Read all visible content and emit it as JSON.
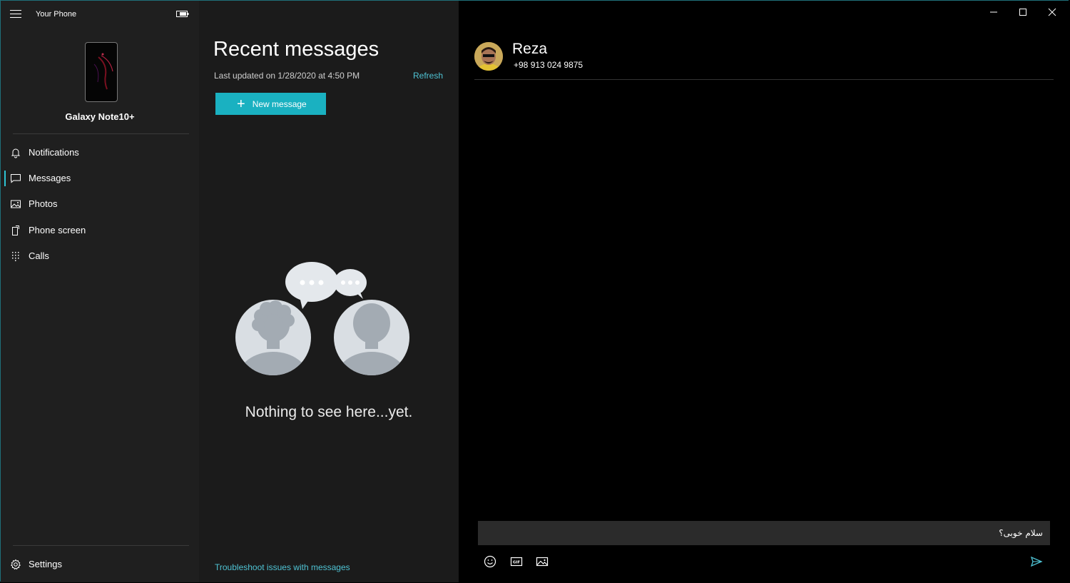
{
  "app": {
    "title": "Your Phone"
  },
  "device": {
    "name": "Galaxy Note10+"
  },
  "sidebar": {
    "items": [
      {
        "label": "Notifications",
        "icon": "bell-icon"
      },
      {
        "label": "Messages",
        "icon": "message-icon",
        "active": true
      },
      {
        "label": "Photos",
        "icon": "photo-icon"
      },
      {
        "label": "Phone screen",
        "icon": "phone-screen-icon"
      },
      {
        "label": "Calls",
        "icon": "dialpad-icon"
      }
    ],
    "settings_label": "Settings"
  },
  "messages_panel": {
    "title": "Recent messages",
    "last_updated": "Last updated on 1/28/2020 at 4:50 PM",
    "refresh_label": "Refresh",
    "new_message_label": "New message",
    "empty_text": "Nothing to see here...yet.",
    "troubleshoot_label": "Troubleshoot issues with messages"
  },
  "conversation": {
    "contact_name": "Reza",
    "contact_phone": "+98 913 024 9875",
    "compose_value": "سلام خوبی؟"
  },
  "colors": {
    "accent": "#1ab1c1",
    "link": "#4fc3d4",
    "sidebar_bg": "#1f1f1f",
    "panel_bg": "#1b1b1b"
  }
}
